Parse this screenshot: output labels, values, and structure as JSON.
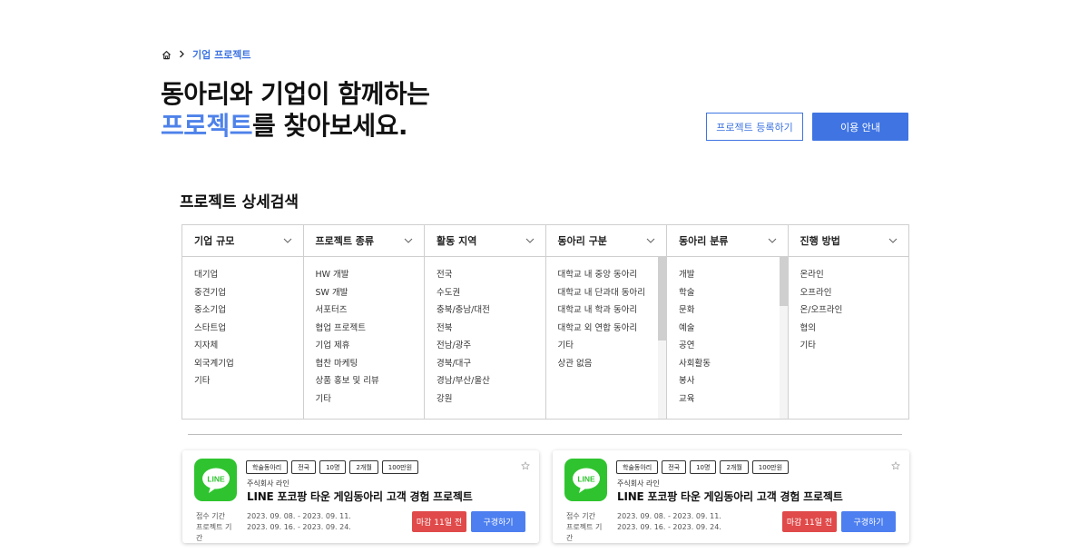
{
  "breadcrumb": {
    "current": "기업 프로젝트"
  },
  "hero": {
    "line1": "동아리와 기업이 함께하는",
    "accent": "프로젝트",
    "line2_rest": "를 찾아보세요."
  },
  "actions": {
    "register": "프로젝트 등록하기",
    "guide": "이용 안내"
  },
  "search": {
    "title": "프로젝트 상세검색",
    "filters": [
      {
        "label": "기업 규모",
        "options": [
          "대기업",
          "중견기업",
          "중소기업",
          "스타트업",
          "지자체",
          "외국계기업",
          "기타"
        ]
      },
      {
        "label": "프로젝트 종류",
        "options": [
          "HW 개발",
          "SW 개발",
          "서포터즈",
          "협업 프로젝트",
          "기업 제휴",
          "협찬 마케팅",
          "상품 홍보 및 리뷰",
          "기타"
        ]
      },
      {
        "label": "활동 지역",
        "options": [
          "전국",
          "수도권",
          "충북/충남/대전",
          "전북",
          "전남/광주",
          "경북/대구",
          "경남/부산/울산",
          "강원"
        ]
      },
      {
        "label": "동아리 구분",
        "options": [
          "대학교 내 중앙 동아리",
          "대학교 내 단과대 동아리",
          "대학교 내 학과 동아리",
          "대학교 외 연합 동아리",
          "기타",
          "상관 없음"
        ]
      },
      {
        "label": "동아리 분류",
        "options": [
          "개발",
          "학술",
          "문화",
          "예술",
          "공연",
          "사회활동",
          "봉사",
          "교육"
        ]
      },
      {
        "label": "진행 방법",
        "options": [
          "온라인",
          "오프라인",
          "온/오프라인",
          "협의",
          "기타"
        ]
      }
    ]
  },
  "cards": [
    {
      "logo_text": "LINE",
      "tags": [
        "학술동아리",
        "전국",
        "10명",
        "2개월",
        "100만원"
      ],
      "company": "주식회사 라인",
      "title": "LINE 포코팡 타운 게임동아리 고객 경험 프로젝트",
      "apply_label": "접수 기간",
      "apply_period": "2023. 09. 08. - 2023. 09. 11.",
      "project_label": "프로젝트 기간",
      "project_period": "2023. 09. 16. - 2023. 09. 24.",
      "deadline": "마감 11일 전",
      "view": "구경하기"
    },
    {
      "logo_text": "LINE",
      "tags": [
        "학술동아리",
        "전국",
        "10명",
        "2개월",
        "100만원"
      ],
      "company": "주식회사 라인",
      "title": "LINE 포코팡 타운 게임동아리 고객 경험 프로젝트",
      "apply_label": "접수 기간",
      "apply_period": "2023. 09. 08. - 2023. 09. 11.",
      "project_label": "프로젝트 기간",
      "project_period": "2023. 09. 16. - 2023. 09. 24.",
      "deadline": "마감 11일 전",
      "view": "구경하기"
    }
  ],
  "colors": {
    "accent": "#3f74e2",
    "accent_text": "#4e82ea",
    "deadline": "#e04a4a",
    "view_button": "#4d7ff0",
    "line_green": "#2fc42f"
  },
  "icons": [
    "home-icon",
    "chevron-right-icon",
    "chevron-down-icon",
    "star-icon"
  ]
}
